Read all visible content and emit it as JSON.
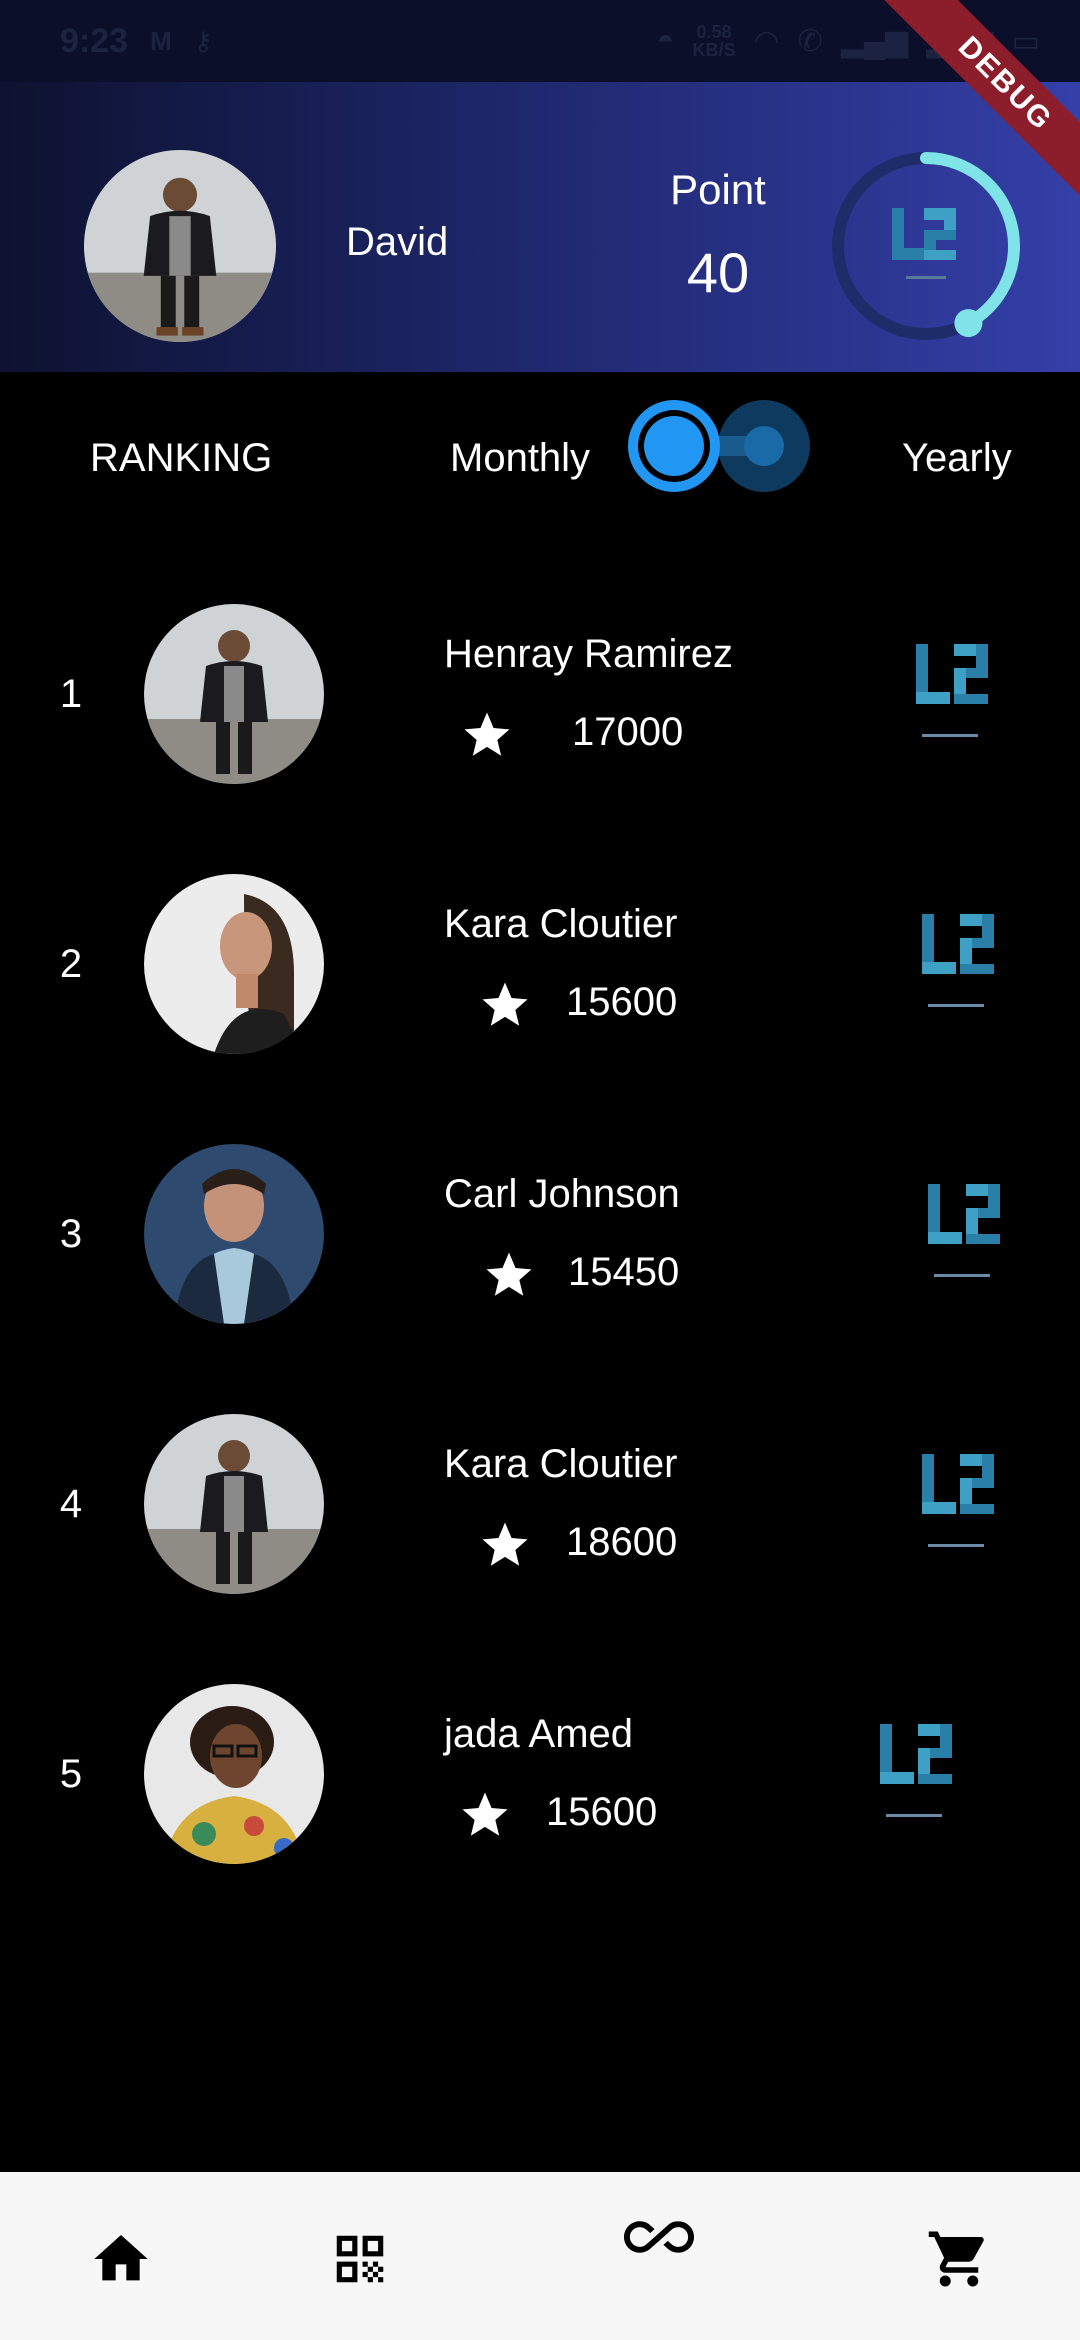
{
  "status_bar": {
    "time": "9:23",
    "left_icons": [
      "gmail-icon",
      "key-icon"
    ],
    "net_speed_value": "0.58",
    "net_speed_unit": "KB/S",
    "right_icons": [
      "vpn-icon",
      "wifi-icon",
      "wifi-calling-icon",
      "signal-icon",
      "signal-icon",
      "battery-icon"
    ]
  },
  "debug_banner": "DEBUG",
  "header": {
    "user_name": "David",
    "point_label": "Point",
    "point_value": "40",
    "progress_fraction": 0.42,
    "accent_color": "#7fe3e8"
  },
  "toggle_row": {
    "ranking_label": "RANKING",
    "monthly_label": "Monthly",
    "yearly_label": "Yearly",
    "selected": "Monthly"
  },
  "ranking": [
    {
      "rank": "1",
      "name": "Henray Ramirez",
      "score": "17000",
      "avatar": "man-jacket-photo"
    },
    {
      "rank": "2",
      "name": "Kara Cloutier",
      "score": "15600",
      "avatar": "woman-photo"
    },
    {
      "rank": "3",
      "name": "Carl Johnson",
      "score": "15450",
      "avatar": "man-blue-shirt-photo"
    },
    {
      "rank": "4",
      "name": "Kara Cloutier",
      "score": "18600",
      "avatar": "man-jacket-photo"
    },
    {
      "rank": "5",
      "name": "jada Amed",
      "score": "15600",
      "avatar": "woman-glasses-photo"
    }
  ],
  "bottom_nav": {
    "items": [
      "home-icon",
      "qr-code-icon",
      "infinity-icon",
      "cart-icon"
    ]
  },
  "colors": {
    "header_gradient_start": "#0d1230",
    "header_gradient_end": "#343fa8",
    "toggle_blue": "#2196f3",
    "nav_background": "#f7f7f7"
  }
}
